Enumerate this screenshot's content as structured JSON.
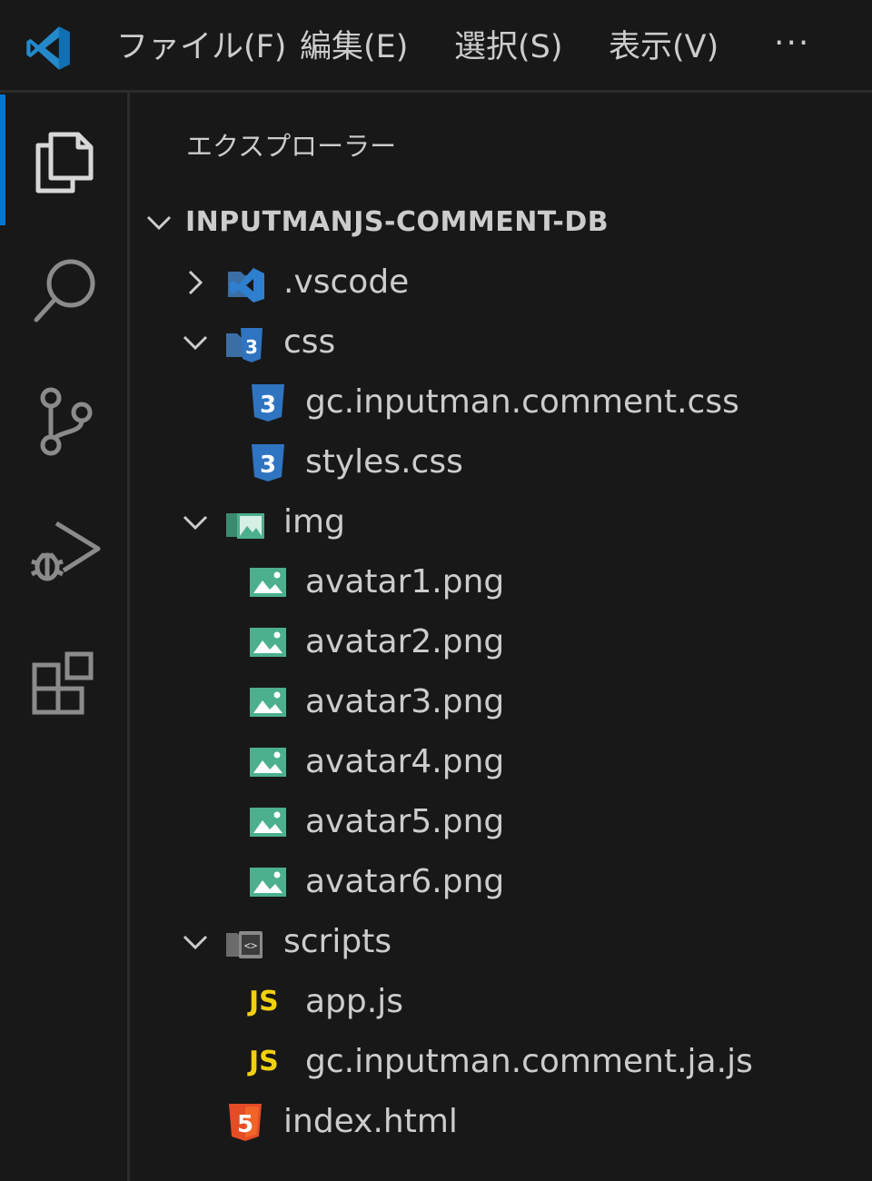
{
  "menubar": {
    "items": [
      "ファイル(F)",
      "編集(E)",
      "選択(S)",
      "表示(V)"
    ],
    "more": "···"
  },
  "activitybar": {
    "icons": [
      "explorer-icon",
      "search-icon",
      "source-control-icon",
      "run-debug-icon",
      "extensions-icon"
    ],
    "active": "explorer-icon"
  },
  "explorer": {
    "title": "エクスプローラー",
    "root": "INPUTMANJS-COMMENT-DB",
    "items": [
      {
        "name": ".vscode",
        "type": "folder",
        "expanded": false,
        "icon": "vscode-folder-icon"
      },
      {
        "name": "css",
        "type": "folder",
        "expanded": true,
        "icon": "css-folder-icon"
      },
      {
        "name": "gc.inputman.comment.css",
        "type": "file",
        "icon": "css-file-icon"
      },
      {
        "name": "styles.css",
        "type": "file",
        "icon": "css-file-icon"
      },
      {
        "name": "img",
        "type": "folder",
        "expanded": true,
        "icon": "image-folder-icon"
      },
      {
        "name": "avatar1.png",
        "type": "file",
        "icon": "image-file-icon"
      },
      {
        "name": "avatar2.png",
        "type": "file",
        "icon": "image-file-icon"
      },
      {
        "name": "avatar3.png",
        "type": "file",
        "icon": "image-file-icon"
      },
      {
        "name": "avatar4.png",
        "type": "file",
        "icon": "image-file-icon"
      },
      {
        "name": "avatar5.png",
        "type": "file",
        "icon": "image-file-icon"
      },
      {
        "name": "avatar6.png",
        "type": "file",
        "icon": "image-file-icon"
      },
      {
        "name": "scripts",
        "type": "folder",
        "expanded": true,
        "icon": "scripts-folder-icon"
      },
      {
        "name": "app.js",
        "type": "file",
        "icon": "js-file-icon"
      },
      {
        "name": "gc.inputman.comment.ja.js",
        "type": "file",
        "icon": "js-file-icon"
      },
      {
        "name": "index.html",
        "type": "file",
        "icon": "html-file-icon"
      }
    ],
    "js_badge": "JS"
  },
  "colors": {
    "background": "#181818",
    "accent": "#0078d4",
    "text": "#cccccc",
    "css_blue": "#2f74c0",
    "image_green": "#4caf8e",
    "js_yellow": "#f1d00f",
    "html_orange": "#e44d26"
  }
}
